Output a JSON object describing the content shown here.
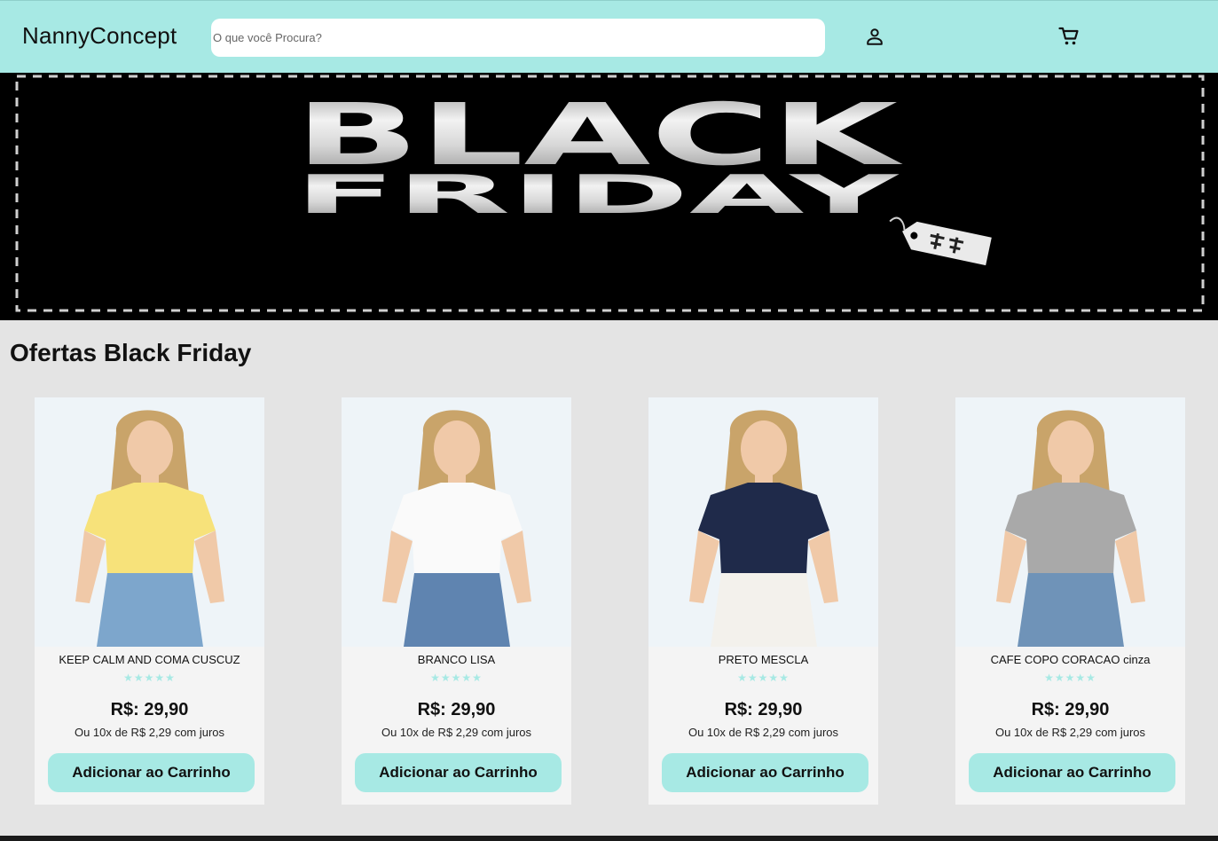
{
  "header": {
    "logo": "NannyConcept",
    "search_placeholder": "O que você Procura?",
    "user_icon": "user-icon",
    "cart_icon": "cart-icon"
  },
  "banner": {
    "line1": "BLACK",
    "line2": "FRIDAY",
    "tag_icon": "price-tag-icon"
  },
  "section": {
    "title": "Ofertas Black Friday"
  },
  "products": [
    {
      "name": "KEEP CALM AND COMA CUSCUZ",
      "stars": "★★★★★",
      "price": "R$: 29,90",
      "installments": "Ou 10x de R$ 2,29 com juros",
      "button": "Adicionar ao Carrinho",
      "shirt_color": "#f7e27a",
      "bottom_color": "#7da6cc"
    },
    {
      "name": "BRANCO LISA",
      "stars": "★★★★★",
      "price": "R$: 29,90",
      "installments": "Ou 10x de R$ 2,29 com juros",
      "button": "Adicionar ao Carrinho",
      "shirt_color": "#fafafa",
      "bottom_color": "#5f84b0"
    },
    {
      "name": "PRETO MESCLA",
      "stars": "★★★★★",
      "price": "R$: 29,90",
      "installments": "Ou 10x de R$ 2,29 com juros",
      "button": "Adicionar ao Carrinho",
      "shirt_color": "#1f2a4a",
      "bottom_color": "#f3f1ec"
    },
    {
      "name": "CAFE COPO CORACAO cinza",
      "stars": "★★★★★",
      "price": "R$: 29,90",
      "installments": "Ou 10x de R$ 2,29 com juros",
      "button": "Adicionar ao Carrinho",
      "shirt_color": "#a9a9a9",
      "bottom_color": "#6f93b8"
    }
  ],
  "colors": {
    "accent": "#a7e9e4",
    "page_bg": "#e4e4e4",
    "card_bg": "#f4f4f4"
  }
}
